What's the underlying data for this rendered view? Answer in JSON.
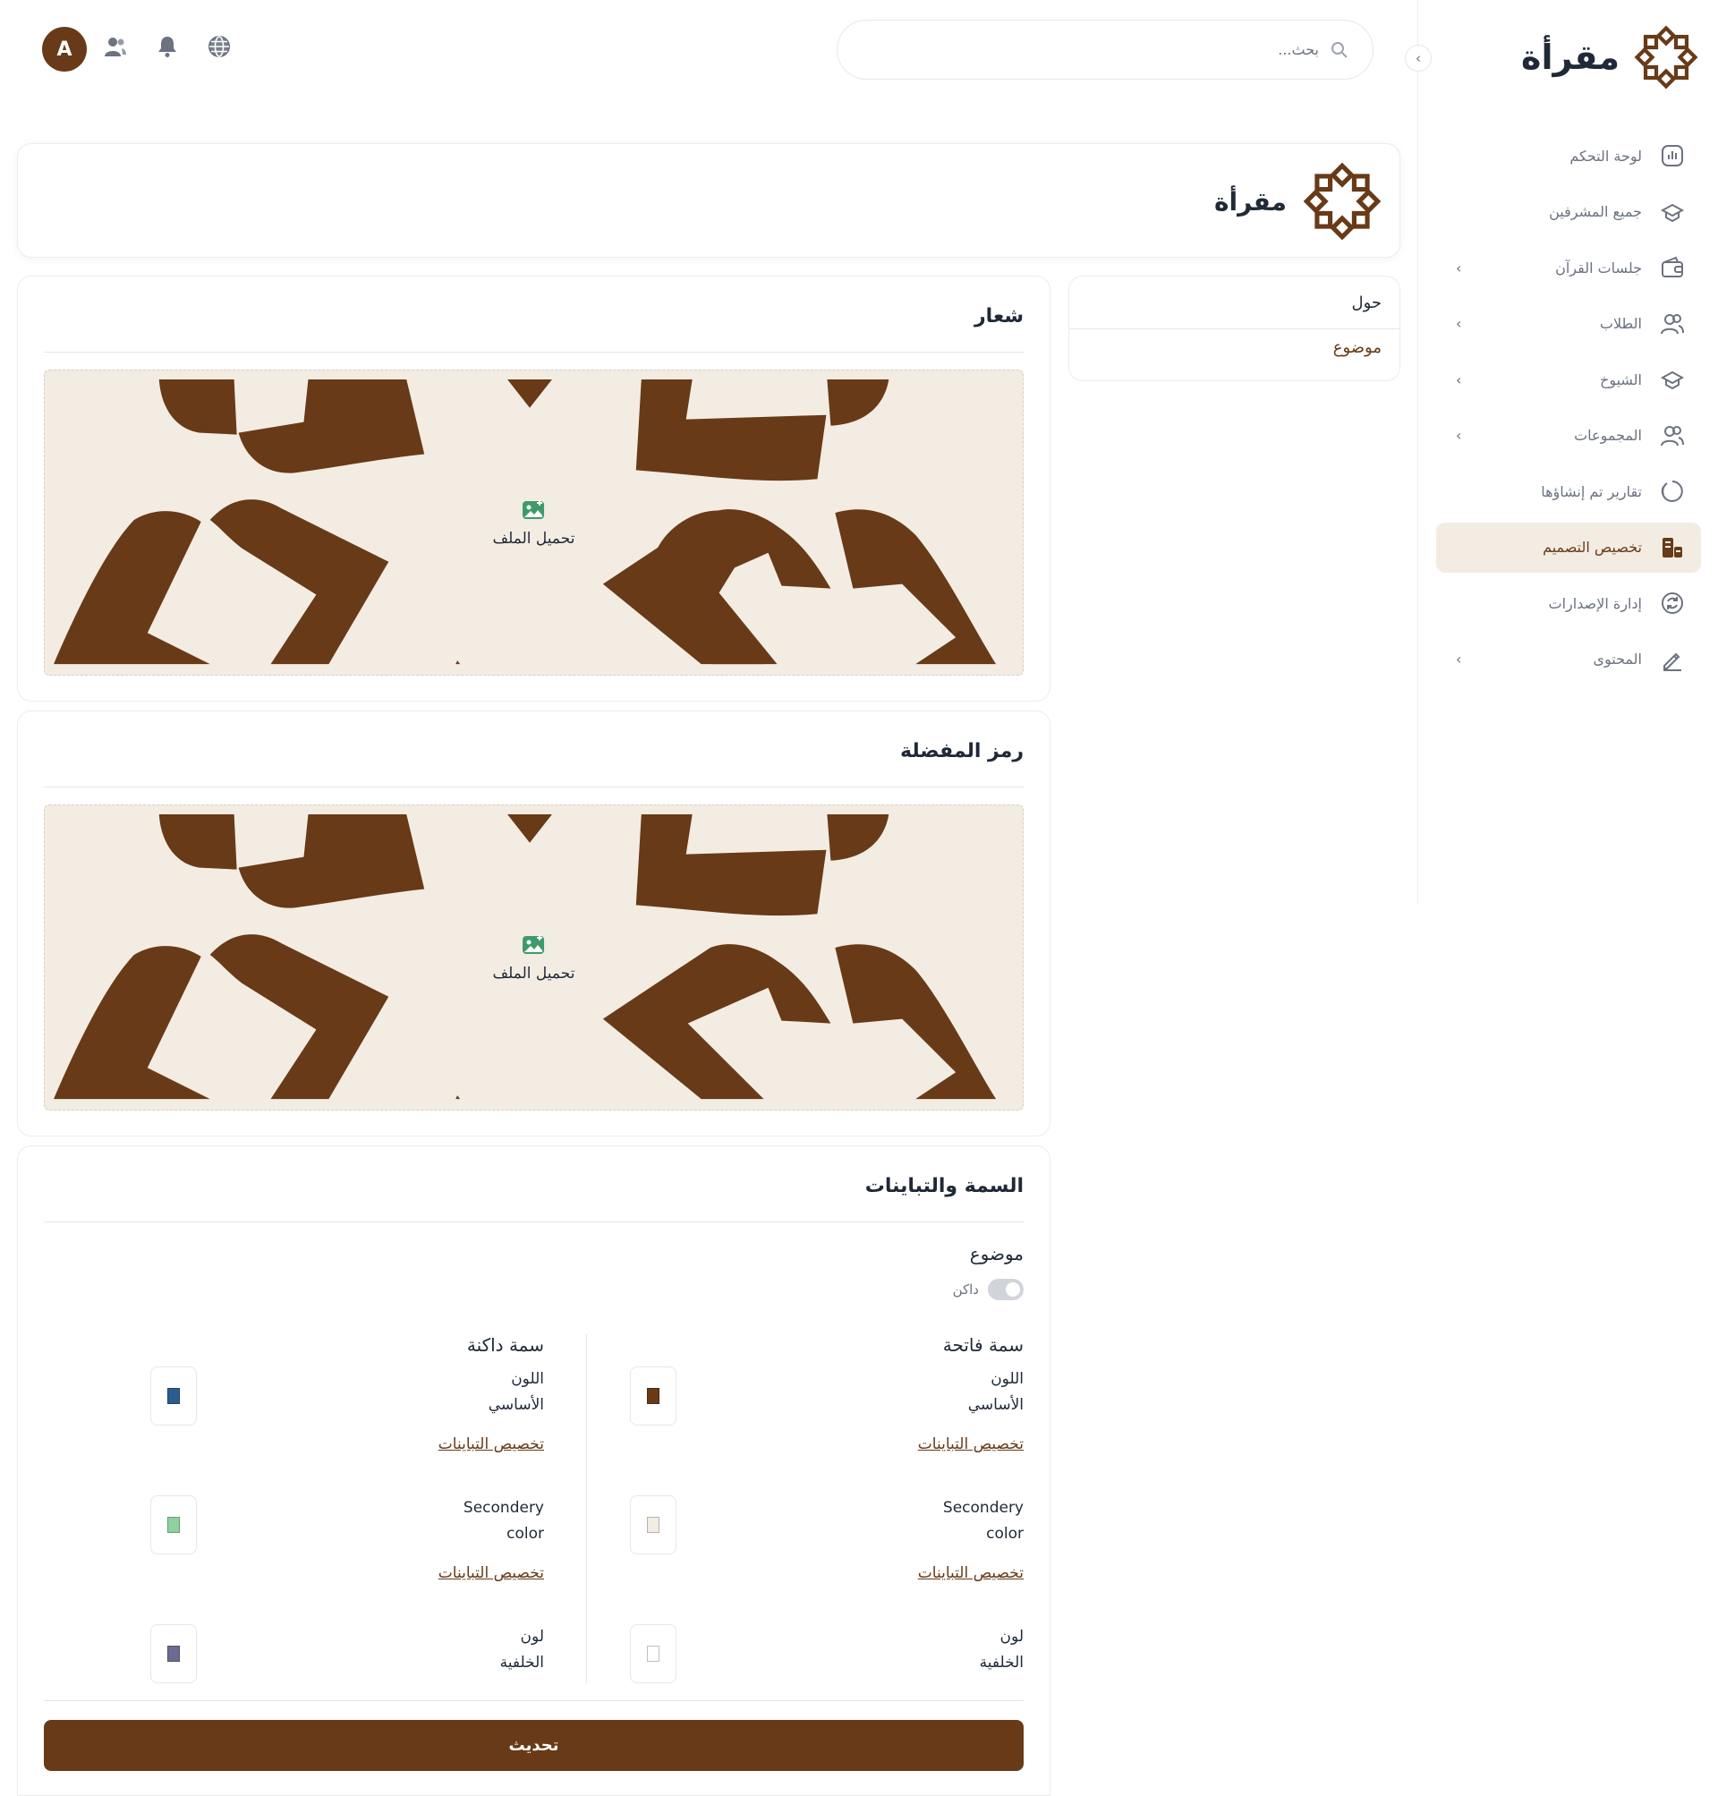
{
  "app": {
    "name": "مقرأة"
  },
  "colors": {
    "brand": "#683a17",
    "brand_light": "#f3ece3"
  },
  "sidebar": {
    "brand": "مقرأة",
    "items": [
      {
        "label": "لوحة التحكم",
        "icon": "dashboard-chart-icon",
        "expandable": false
      },
      {
        "label": "جميع المشرفين",
        "icon": "graduation-cap-icon",
        "expandable": false
      },
      {
        "label": "جلسات القرآن",
        "icon": "wallet-icon",
        "expandable": true
      },
      {
        "label": "الطلاب",
        "icon": "users-icon",
        "expandable": true
      },
      {
        "label": "الشيوخ",
        "icon": "graduation-cap-icon",
        "expandable": true
      },
      {
        "label": "المجموعات",
        "icon": "users-icon",
        "expandable": true
      },
      {
        "label": "تقارير تم إنشاؤها",
        "icon": "circle-progress-icon",
        "expandable": false
      },
      {
        "label": "تخصيص التصميم",
        "icon": "design-icon",
        "expandable": false,
        "active": true
      },
      {
        "label": "إدارة الإصدارات",
        "icon": "refresh-icon",
        "expandable": false
      },
      {
        "label": "المحتوى",
        "icon": "pencil-icon",
        "expandable": true
      }
    ]
  },
  "header": {
    "search_placeholder": "بحث...",
    "avatar_initial": "A",
    "icons": [
      "globe-icon",
      "bell-icon",
      "users-icon"
    ]
  },
  "logo_card": {
    "name": "مقرأة"
  },
  "settings_menu": {
    "items": [
      "حول",
      "موضوع"
    ],
    "active_index": 1
  },
  "logo_section": {
    "title": "شعار",
    "upload_label": "تحميل الملف"
  },
  "favicon_section": {
    "title": "رمز المفضلة",
    "upload_label": "تحميل الملف"
  },
  "theme_section": {
    "title": "السمة والتباينات",
    "subtitle": "موضوع",
    "toggle_label": "داكن",
    "light": {
      "title": "سمة فاتحة",
      "rows": [
        {
          "label_line1": "اللون",
          "label_line2": "الأساسي",
          "color": "#683a17",
          "link": "تخصيص التباينات"
        },
        {
          "label_line1": "Secondery",
          "label_line2": "color",
          "color": "#f3ece3",
          "link": "تخصيص التباينات"
        },
        {
          "label_line1": "لون",
          "label_line2": "الخلفية",
          "color": "#ffffff"
        }
      ]
    },
    "dark": {
      "title": "سمة داكنة",
      "rows": [
        {
          "label_line1": "اللون",
          "label_line2": "الأساسي",
          "color": "#2b5b8f",
          "link": "تخصيص التباينات"
        },
        {
          "label_line1": "Secondery",
          "label_line2": "color",
          "color": "#8fd19e",
          "link": "تخصيص التباينات"
        },
        {
          "label_line1": "لون",
          "label_line2": "الخلفية",
          "color": "#6b6b8f"
        }
      ]
    },
    "update_button": "تحديث"
  }
}
